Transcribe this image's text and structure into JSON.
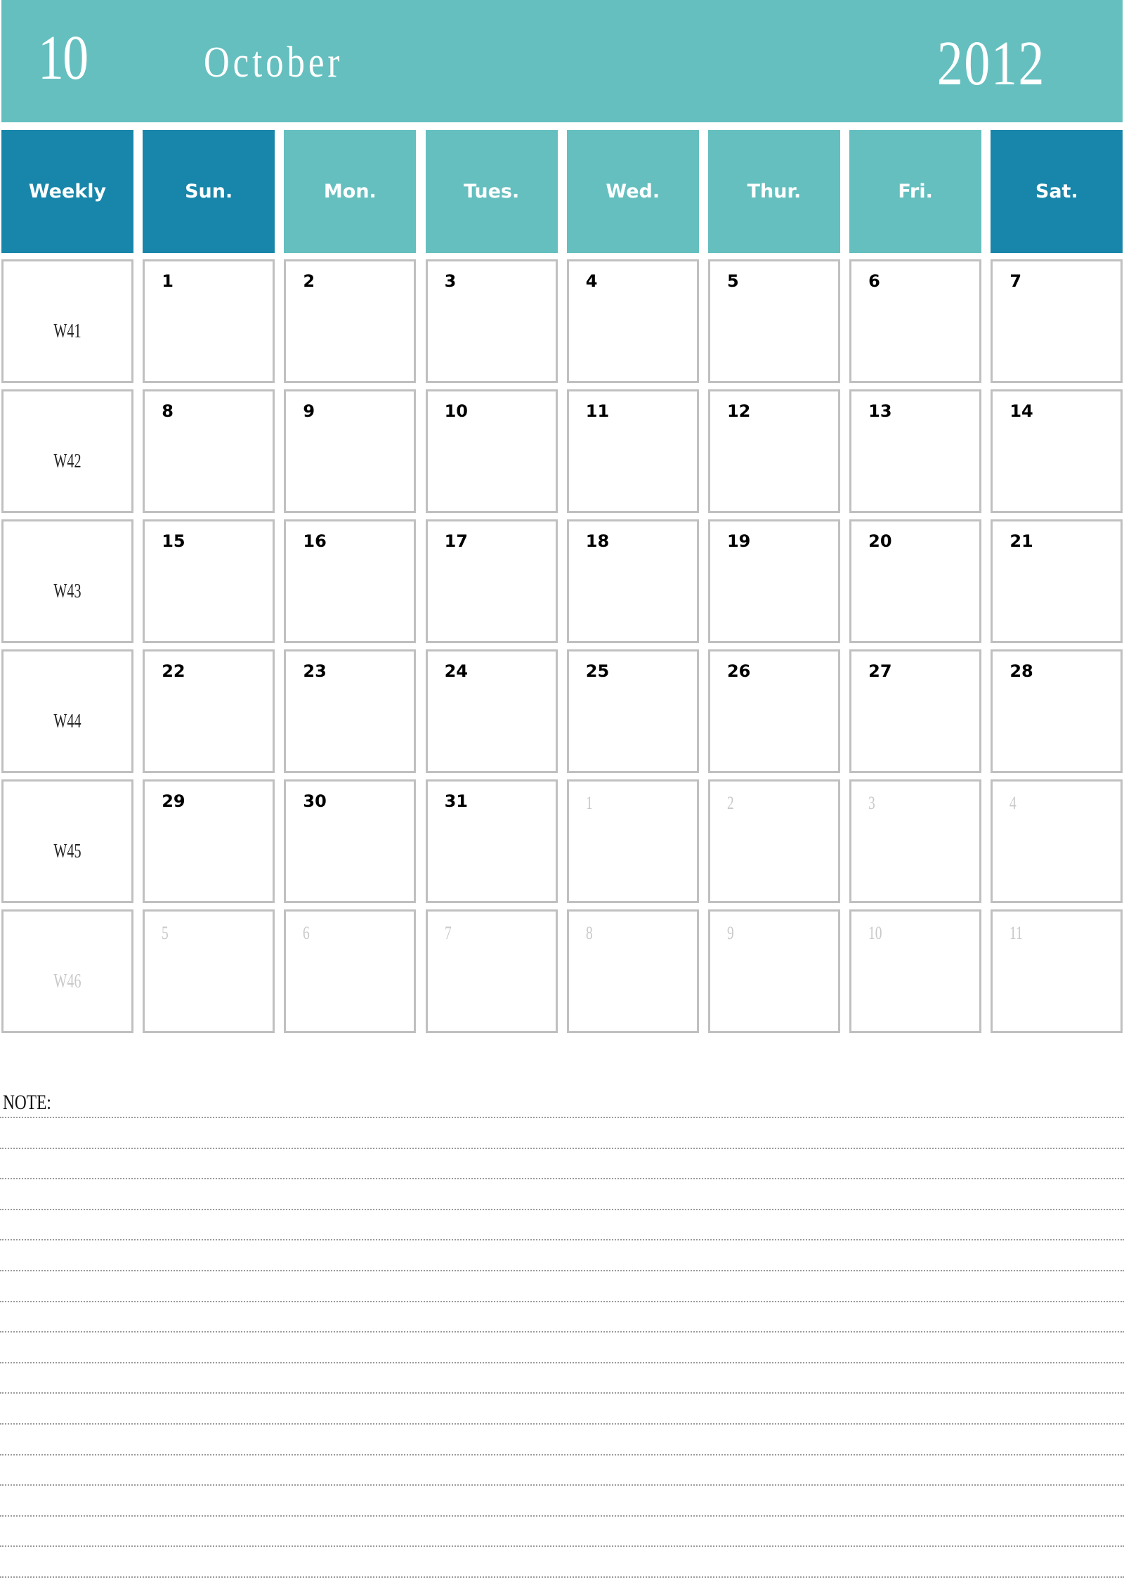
{
  "header": {
    "month_number": "10",
    "month_name": "October",
    "year": "2012"
  },
  "colors": {
    "banner": "#65bfbf",
    "weekday_header": "#65bfbf",
    "weekend_header": "#1886aa",
    "cell_border": "#c0c0c0",
    "out_of_month_text": "#c9c9c9"
  },
  "columns": [
    {
      "label": "Weekly",
      "style": "dark"
    },
    {
      "label": "Sun.",
      "style": "dark"
    },
    {
      "label": "Mon.",
      "style": "light"
    },
    {
      "label": "Tues.",
      "style": "light"
    },
    {
      "label": "Wed.",
      "style": "light"
    },
    {
      "label": "Thur.",
      "style": "light"
    },
    {
      "label": "Fri.",
      "style": "light"
    },
    {
      "label": "Sat.",
      "style": "dark"
    }
  ],
  "weeks": [
    {
      "week": "W41",
      "in_month": true,
      "days": [
        {
          "d": "1",
          "in": true
        },
        {
          "d": "2",
          "in": true
        },
        {
          "d": "3",
          "in": true
        },
        {
          "d": "4",
          "in": true
        },
        {
          "d": "5",
          "in": true
        },
        {
          "d": "6",
          "in": true
        },
        {
          "d": "7",
          "in": true
        }
      ]
    },
    {
      "week": "W42",
      "in_month": true,
      "days": [
        {
          "d": "8",
          "in": true
        },
        {
          "d": "9",
          "in": true
        },
        {
          "d": "10",
          "in": true
        },
        {
          "d": "11",
          "in": true
        },
        {
          "d": "12",
          "in": true
        },
        {
          "d": "13",
          "in": true
        },
        {
          "d": "14",
          "in": true
        }
      ]
    },
    {
      "week": "W43",
      "in_month": true,
      "days": [
        {
          "d": "15",
          "in": true
        },
        {
          "d": "16",
          "in": true
        },
        {
          "d": "17",
          "in": true
        },
        {
          "d": "18",
          "in": true
        },
        {
          "d": "19",
          "in": true
        },
        {
          "d": "20",
          "in": true
        },
        {
          "d": "21",
          "in": true
        }
      ]
    },
    {
      "week": "W44",
      "in_month": true,
      "days": [
        {
          "d": "22",
          "in": true
        },
        {
          "d": "23",
          "in": true
        },
        {
          "d": "24",
          "in": true
        },
        {
          "d": "25",
          "in": true
        },
        {
          "d": "26",
          "in": true
        },
        {
          "d": "27",
          "in": true
        },
        {
          "d": "28",
          "in": true
        }
      ]
    },
    {
      "week": "W45",
      "in_month": true,
      "days": [
        {
          "d": "29",
          "in": true
        },
        {
          "d": "30",
          "in": true
        },
        {
          "d": "31",
          "in": true
        },
        {
          "d": "1",
          "in": false
        },
        {
          "d": "2",
          "in": false
        },
        {
          "d": "3",
          "in": false
        },
        {
          "d": "4",
          "in": false
        }
      ]
    },
    {
      "week": "W46",
      "in_month": false,
      "days": [
        {
          "d": "5",
          "in": false
        },
        {
          "d": "6",
          "in": false
        },
        {
          "d": "7",
          "in": false
        },
        {
          "d": "8",
          "in": false
        },
        {
          "d": "9",
          "in": false
        },
        {
          "d": "10",
          "in": false
        },
        {
          "d": "11",
          "in": false
        }
      ]
    }
  ],
  "notes": {
    "label": "NOTE:",
    "line_count": 16
  }
}
